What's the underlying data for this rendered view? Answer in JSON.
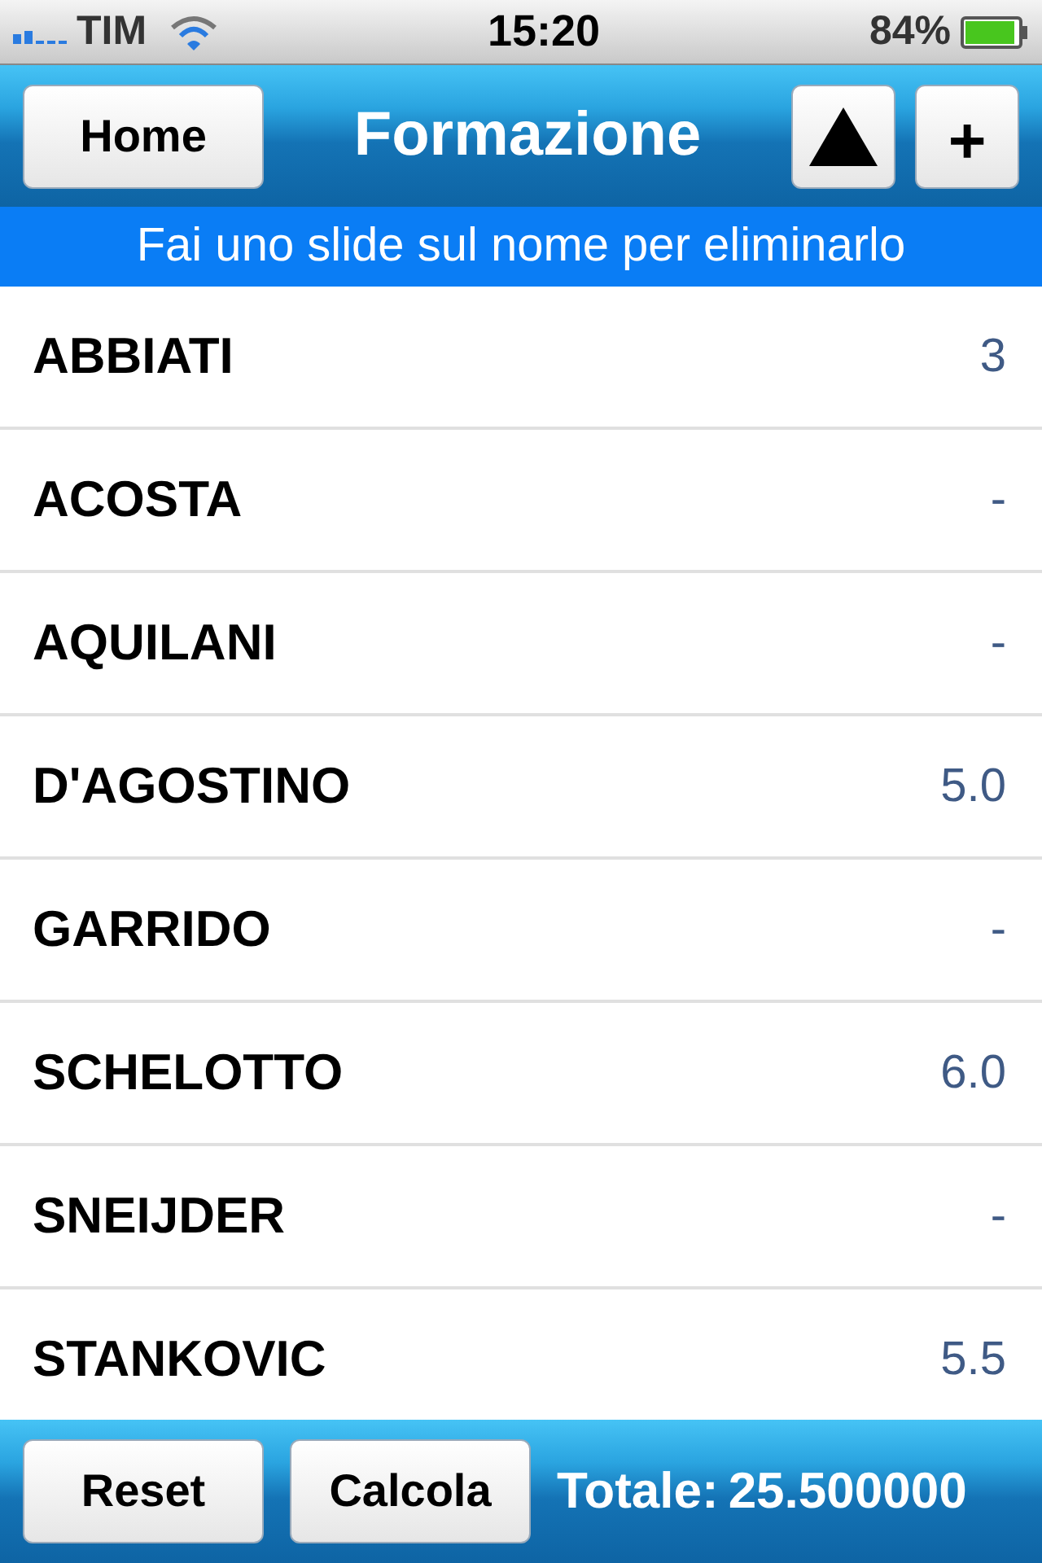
{
  "status_bar": {
    "carrier": "TIM",
    "time": "15:20",
    "battery": "84%"
  },
  "nav_bar": {
    "home": "Home",
    "title": "Formazione",
    "add": "+"
  },
  "hint": "Fai uno slide sul nome per eliminarlo",
  "players": [
    {
      "name": "ABBIATI",
      "value": "3"
    },
    {
      "name": "ACOSTA",
      "value": "-"
    },
    {
      "name": "AQUILANI",
      "value": "-"
    },
    {
      "name": "D'AGOSTINO",
      "value": "5.0"
    },
    {
      "name": "GARRIDO",
      "value": "-"
    },
    {
      "name": "SCHELOTTO",
      "value": "6.0"
    },
    {
      "name": "SNEIJDER",
      "value": "-"
    },
    {
      "name": "STANKOVIC",
      "value": "5.5"
    }
  ],
  "toolbar": {
    "reset": "Reset",
    "calcola": "Calcola",
    "total_label": "Totale:",
    "total_value": "25.500000"
  }
}
